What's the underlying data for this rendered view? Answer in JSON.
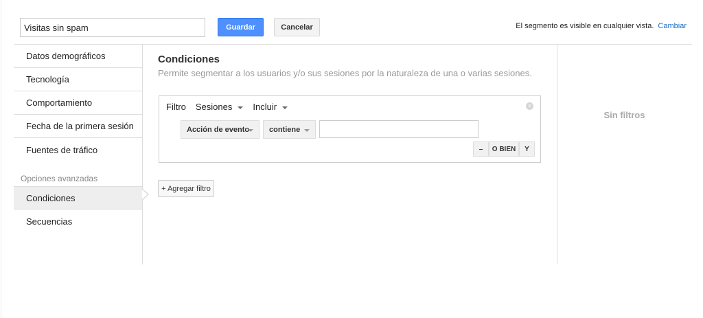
{
  "header": {
    "segment_name": "Visitas sin spam",
    "save_label": "Guardar",
    "cancel_label": "Cancelar",
    "visibility_text": "El segmento es visible en cualquier vista.",
    "change_link": "Cambiar"
  },
  "sidebar": {
    "items": [
      "Datos demográficos",
      "Tecnología",
      "Comportamiento",
      "Fecha de la primera sesión",
      "Fuentes de tráfico"
    ],
    "advanced_label": "Opciones avanzadas",
    "advanced_items": [
      "Condiciones",
      "Secuencias"
    ],
    "active": "Condiciones"
  },
  "main": {
    "title": "Condiciones",
    "subtitle": "Permite segmentar a los usuarios y/o sus sesiones por la naturaleza de una o varias sesiones.",
    "filter": {
      "label": "Filtro",
      "scope": "Sesiones",
      "mode": "Incluir",
      "dimension": "Acción de evento",
      "operator": "contiene",
      "value": "",
      "remove_label": "–",
      "or_label": "O BIEN",
      "and_label": "Y"
    },
    "add_filter_label": "+ Agregar filtro"
  },
  "summary": {
    "empty_text": "Sin filtros"
  },
  "colors": {
    "accent": "#4d90fe",
    "link": "#1a6dc7"
  }
}
